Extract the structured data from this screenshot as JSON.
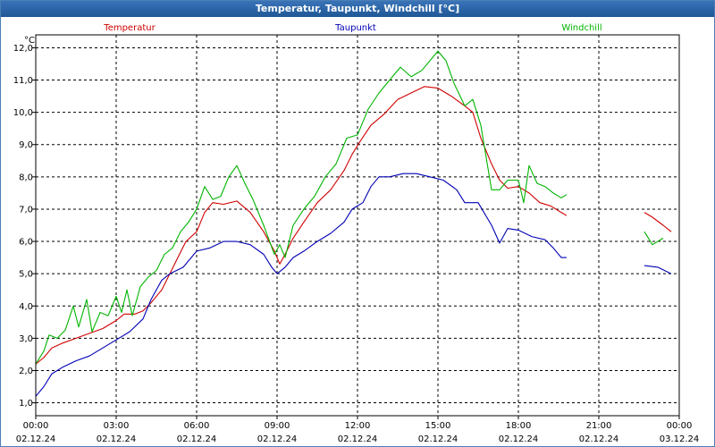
{
  "window": {
    "title": "Temperatur, Taupunkt, Windchill [°C]"
  },
  "chart_data": {
    "type": "line",
    "title": "Temperatur, Taupunkt, Windchill [°C]",
    "ylabel": "°C",
    "ylim": [
      0.6,
      12.4
    ],
    "xlim": [
      0,
      24
    ],
    "grid": true,
    "legend_position": "top",
    "yticks": [
      1.0,
      2.0,
      3.0,
      4.0,
      5.0,
      6.0,
      7.0,
      8.0,
      9.0,
      10.0,
      11.0,
      12.0
    ],
    "yticks_labels": [
      "1,0",
      "2,0",
      "3,0",
      "4,0",
      "5,0",
      "6,0",
      "7,0",
      "8,0",
      "9,0",
      "10,0",
      "11,0",
      "12,0"
    ],
    "xticks": [
      {
        "x": 0,
        "time": "00:00",
        "date": "02.12.24"
      },
      {
        "x": 3,
        "time": "03:00",
        "date": "02.12.24"
      },
      {
        "x": 6,
        "time": "06:00",
        "date": "02.12.24"
      },
      {
        "x": 9,
        "time": "09:00",
        "date": "02.12.24"
      },
      {
        "x": 12,
        "time": "12:00",
        "date": "02.12.24"
      },
      {
        "x": 15,
        "time": "15:00",
        "date": "02.12.24"
      },
      {
        "x": 18,
        "time": "18:00",
        "date": "02.12.24"
      },
      {
        "x": 21,
        "time": "21:00",
        "date": "02.12.24"
      },
      {
        "x": 24,
        "time": "00:00",
        "date": "03.12.24"
      }
    ],
    "series": [
      {
        "name": "Temperatur",
        "color": "#d00000",
        "segments": [
          [
            [
              0,
              2.2
            ],
            [
              0.3,
              2.4
            ],
            [
              0.6,
              2.7
            ],
            [
              1,
              2.85
            ],
            [
              1.5,
              3.0
            ],
            [
              2,
              3.15
            ],
            [
              2.5,
              3.3
            ],
            [
              3,
              3.55
            ],
            [
              3.3,
              3.75
            ],
            [
              3.7,
              3.75
            ],
            [
              4,
              3.85
            ],
            [
              4.3,
              4.1
            ],
            [
              4.7,
              4.5
            ],
            [
              5,
              5.0
            ],
            [
              5.3,
              5.5
            ],
            [
              5.6,
              6.0
            ],
            [
              6,
              6.3
            ],
            [
              6.3,
              6.9
            ],
            [
              6.6,
              7.2
            ],
            [
              7,
              7.15
            ],
            [
              7.5,
              7.25
            ],
            [
              8,
              6.9
            ],
            [
              8.5,
              6.3
            ],
            [
              8.9,
              5.7
            ],
            [
              9.1,
              5.3
            ],
            [
              9.3,
              5.6
            ],
            [
              9.6,
              6.1
            ],
            [
              10,
              6.6
            ],
            [
              10.5,
              7.2
            ],
            [
              11,
              7.6
            ],
            [
              11.5,
              8.2
            ],
            [
              11.8,
              8.7
            ],
            [
              12.1,
              9.1
            ],
            [
              12.5,
              9.6
            ],
            [
              13,
              9.95
            ],
            [
              13.5,
              10.4
            ],
            [
              14,
              10.6
            ],
            [
              14.5,
              10.8
            ],
            [
              15,
              10.75
            ],
            [
              15.5,
              10.5
            ],
            [
              16,
              10.2
            ],
            [
              16.3,
              10.0
            ],
            [
              16.6,
              9.2
            ],
            [
              17,
              8.4
            ],
            [
              17.3,
              7.9
            ],
            [
              17.6,
              7.65
            ],
            [
              18,
              7.7
            ],
            [
              18.4,
              7.5
            ],
            [
              18.8,
              7.2
            ],
            [
              19.2,
              7.1
            ],
            [
              19.6,
              6.9
            ],
            [
              19.8,
              6.8
            ]
          ],
          [
            [
              22.7,
              6.9
            ],
            [
              23,
              6.75
            ],
            [
              23.4,
              6.5
            ],
            [
              23.7,
              6.3
            ]
          ]
        ]
      },
      {
        "name": "Taupunkt",
        "color": "#0000b4",
        "segments": [
          [
            [
              0,
              1.2
            ],
            [
              0.3,
              1.5
            ],
            [
              0.6,
              1.9
            ],
            [
              1,
              2.1
            ],
            [
              1.5,
              2.3
            ],
            [
              2,
              2.45
            ],
            [
              2.5,
              2.7
            ],
            [
              3,
              2.95
            ],
            [
              3.5,
              3.2
            ],
            [
              4,
              3.6
            ],
            [
              4.3,
              4.2
            ],
            [
              4.7,
              4.8
            ],
            [
              5,
              5.0
            ],
            [
              5.5,
              5.2
            ],
            [
              6,
              5.7
            ],
            [
              6.5,
              5.8
            ],
            [
              7,
              6.0
            ],
            [
              7.5,
              6.0
            ],
            [
              8,
              5.9
            ],
            [
              8.5,
              5.6
            ],
            [
              8.8,
              5.2
            ],
            [
              9,
              5.0
            ],
            [
              9.3,
              5.2
            ],
            [
              9.6,
              5.5
            ],
            [
              10,
              5.7
            ],
            [
              10.5,
              6.0
            ],
            [
              11,
              6.25
            ],
            [
              11.5,
              6.6
            ],
            [
              11.8,
              7.0
            ],
            [
              12.2,
              7.2
            ],
            [
              12.5,
              7.7
            ],
            [
              12.8,
              8.0
            ],
            [
              13.2,
              8.0
            ],
            [
              13.7,
              8.1
            ],
            [
              14.2,
              8.1
            ],
            [
              14.7,
              8.0
            ],
            [
              15.2,
              7.9
            ],
            [
              15.7,
              7.6
            ],
            [
              16,
              7.2
            ],
            [
              16.5,
              7.2
            ],
            [
              17,
              6.5
            ],
            [
              17.3,
              5.95
            ],
            [
              17.6,
              6.4
            ],
            [
              18,
              6.35
            ],
            [
              18.5,
              6.15
            ],
            [
              19,
              6.05
            ],
            [
              19.3,
              5.8
            ],
            [
              19.6,
              5.5
            ],
            [
              19.8,
              5.5
            ]
          ],
          [
            [
              22.7,
              5.25
            ],
            [
              23.2,
              5.2
            ],
            [
              23.7,
              5.0
            ]
          ]
        ]
      },
      {
        "name": "Windchill",
        "color": "#00b400",
        "segments": [
          [
            [
              0,
              2.2
            ],
            [
              0.3,
              2.6
            ],
            [
              0.5,
              3.1
            ],
            [
              0.8,
              3.0
            ],
            [
              1.1,
              3.25
            ],
            [
              1.4,
              4.0
            ],
            [
              1.6,
              3.35
            ],
            [
              1.9,
              4.2
            ],
            [
              2.1,
              3.2
            ],
            [
              2.4,
              3.8
            ],
            [
              2.7,
              3.7
            ],
            [
              3,
              4.3
            ],
            [
              3.2,
              3.8
            ],
            [
              3.4,
              4.5
            ],
            [
              3.6,
              3.7
            ],
            [
              3.9,
              4.6
            ],
            [
              4.2,
              4.9
            ],
            [
              4.5,
              5.1
            ],
            [
              4.8,
              5.6
            ],
            [
              5.1,
              5.8
            ],
            [
              5.4,
              6.3
            ],
            [
              5.7,
              6.6
            ],
            [
              6,
              7.0
            ],
            [
              6.3,
              7.7
            ],
            [
              6.6,
              7.3
            ],
            [
              6.9,
              7.4
            ],
            [
              7.2,
              8.0
            ],
            [
              7.5,
              8.35
            ],
            [
              7.8,
              7.8
            ],
            [
              8.1,
              7.3
            ],
            [
              8.5,
              6.5
            ],
            [
              8.9,
              5.6
            ],
            [
              9.1,
              5.9
            ],
            [
              9.3,
              5.5
            ],
            [
              9.6,
              6.5
            ],
            [
              10,
              7.0
            ],
            [
              10.4,
              7.4
            ],
            [
              10.8,
              8.0
            ],
            [
              11.2,
              8.4
            ],
            [
              11.6,
              9.2
            ],
            [
              12,
              9.3
            ],
            [
              12.4,
              10.1
            ],
            [
              12.8,
              10.6
            ],
            [
              13.2,
              11.0
            ],
            [
              13.6,
              11.4
            ],
            [
              14,
              11.1
            ],
            [
              14.4,
              11.3
            ],
            [
              14.7,
              11.6
            ],
            [
              15,
              11.9
            ],
            [
              15.3,
              11.6
            ],
            [
              15.6,
              10.9
            ],
            [
              16,
              10.2
            ],
            [
              16.3,
              10.4
            ],
            [
              16.6,
              9.6
            ],
            [
              17,
              7.6
            ],
            [
              17.3,
              7.6
            ],
            [
              17.6,
              7.9
            ],
            [
              18,
              7.9
            ],
            [
              18.2,
              7.2
            ],
            [
              18.4,
              8.35
            ],
            [
              18.7,
              7.8
            ],
            [
              19,
              7.7
            ],
            [
              19.3,
              7.5
            ],
            [
              19.6,
              7.35
            ],
            [
              19.8,
              7.45
            ]
          ],
          [
            [
              22.7,
              6.3
            ],
            [
              23,
              5.9
            ],
            [
              23.4,
              6.1
            ]
          ]
        ]
      }
    ]
  }
}
